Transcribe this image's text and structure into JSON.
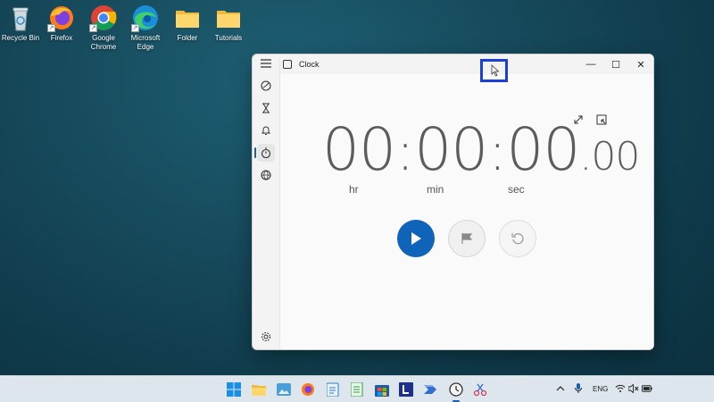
{
  "desktop": {
    "icons": [
      {
        "label": "Recycle Bin",
        "icon": "recycle-bin-icon"
      },
      {
        "label": "Firefox",
        "icon": "firefox-icon"
      },
      {
        "label": "Google Chrome",
        "icon": "chrome-icon"
      },
      {
        "label": "Microsoft Edge",
        "icon": "edge-icon"
      },
      {
        "label": "Folder",
        "icon": "folder-icon"
      },
      {
        "label": "Tutorials",
        "icon": "folder-icon"
      }
    ]
  },
  "window": {
    "title": "Clock",
    "controls": {
      "minimize": "—",
      "maximize": "☐",
      "close": "✕"
    }
  },
  "nav": {
    "items": [
      {
        "icon": "hamburger-menu-icon"
      },
      {
        "icon": "focus-sessions-icon"
      },
      {
        "icon": "timer-icon"
      },
      {
        "icon": "alarm-icon"
      },
      {
        "icon": "stopwatch-icon"
      },
      {
        "icon": "world-clock-icon"
      }
    ],
    "active": "stopwatch-icon",
    "settings_icon": "gear-icon"
  },
  "stopwatch": {
    "hours": "00",
    "minutes": "00",
    "seconds": "00",
    "separator": ":",
    "hundredths": ".00",
    "unit_hr": "hr",
    "unit_min": "min",
    "unit_sec": "sec"
  },
  "taskbar": {
    "apps": [
      "windows-start-icon",
      "file-explorer-icon",
      "photos-icon",
      "firefox-icon",
      "notepad-icon",
      "spreadsheet-icon",
      "microsoft-store-icon",
      "l-app-icon",
      "power-automate-icon",
      "clock-icon",
      "snipping-tool-icon"
    ],
    "active_app": "clock-icon",
    "language": "ENG"
  },
  "colors": {
    "accent": "#0f63b8",
    "selection": "#1c3fd6"
  }
}
